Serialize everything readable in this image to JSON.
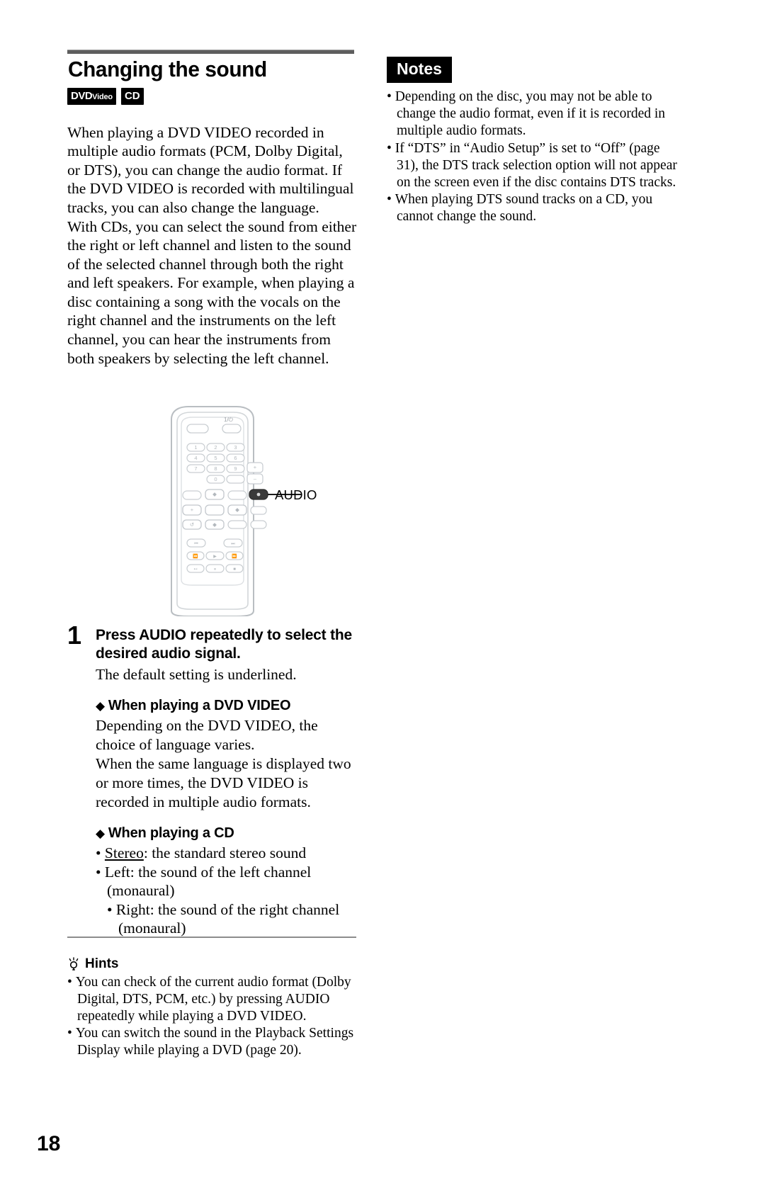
{
  "page": {
    "number": "18"
  },
  "left": {
    "section_title": "Changing the sound",
    "badges": [
      {
        "name": "dvd-video-badge",
        "main": "DVD",
        "sub": "Video"
      },
      {
        "name": "cd-badge",
        "main": "CD",
        "sub": ""
      }
    ],
    "paragraphs": [
      "When playing a DVD VIDEO recorded in multiple audio formats (PCM, Dolby Digital, or DTS), you can change the audio format. If the DVD VIDEO is recorded with multilingual tracks, you can also change the language.",
      "With CDs, you can select the sound from either the right or left channel and listen to the sound of the selected channel through both the right and left speakers. For example, when playing a disc containing a song with the vocals on the right channel and the instruments on the left channel, you can hear the instruments from both speakers by selecting the left channel."
    ]
  },
  "figure": {
    "callout_label": "AUDIO",
    "power_label": "1/⏻",
    "keypad": [
      "1",
      "2",
      "3",
      "4",
      "5",
      "6",
      "7",
      "8",
      "9",
      "0"
    ],
    "plus_label": "+",
    "minus_label": "–"
  },
  "step": {
    "number": "1",
    "heading": "Press AUDIO repeatedly to select the desired audio signal.",
    "subtext": "The default setting is underlined.",
    "sections": [
      {
        "heading": "When playing a DVD VIDEO",
        "paragraphs": [
          "Depending on the DVD VIDEO, the choice of language varies.",
          "When the same language is displayed two or more times, the DVD VIDEO is recorded in multiple audio formats."
        ],
        "items": []
      },
      {
        "heading": "When playing a CD",
        "paragraphs": [],
        "items": [
          {
            "term": "Stereo",
            "underlined": true,
            "rest": ": the standard stereo sound",
            "indented": false
          },
          {
            "term": "Left",
            "underlined": false,
            "rest": ": the sound of the left channel (monaural)",
            "indented": false
          },
          {
            "term": "Right",
            "underlined": false,
            "rest": ": the sound of the right channel (monaural)",
            "indented": true
          }
        ]
      }
    ]
  },
  "hints": {
    "title": "Hints",
    "icon": "lightbulb-icon",
    "items": [
      "You can check of the current audio format (Dolby Digital, DTS, PCM, etc.) by pressing AUDIO repeatedly while playing a DVD VIDEO.",
      "You can switch the sound in the Playback Settings Display while playing a DVD (page 20)."
    ]
  },
  "notes": {
    "title": "Notes",
    "items": [
      "Depending on the disc, you may not be able to change the audio format, even if it is recorded in multiple audio formats.",
      "If “DTS” in “Audio Setup” is set to “Off” (page 31), the DTS track selection option will not appear on the screen even if the disc contains DTS tracks.",
      "When playing DTS sound tracks on a CD, you cannot change the sound."
    ]
  },
  "colors": {
    "rule": "#5e5e5e",
    "badge_bg": "#000000",
    "remote_outline": "#b9bec2",
    "audio_button": "#3a3a3a"
  }
}
